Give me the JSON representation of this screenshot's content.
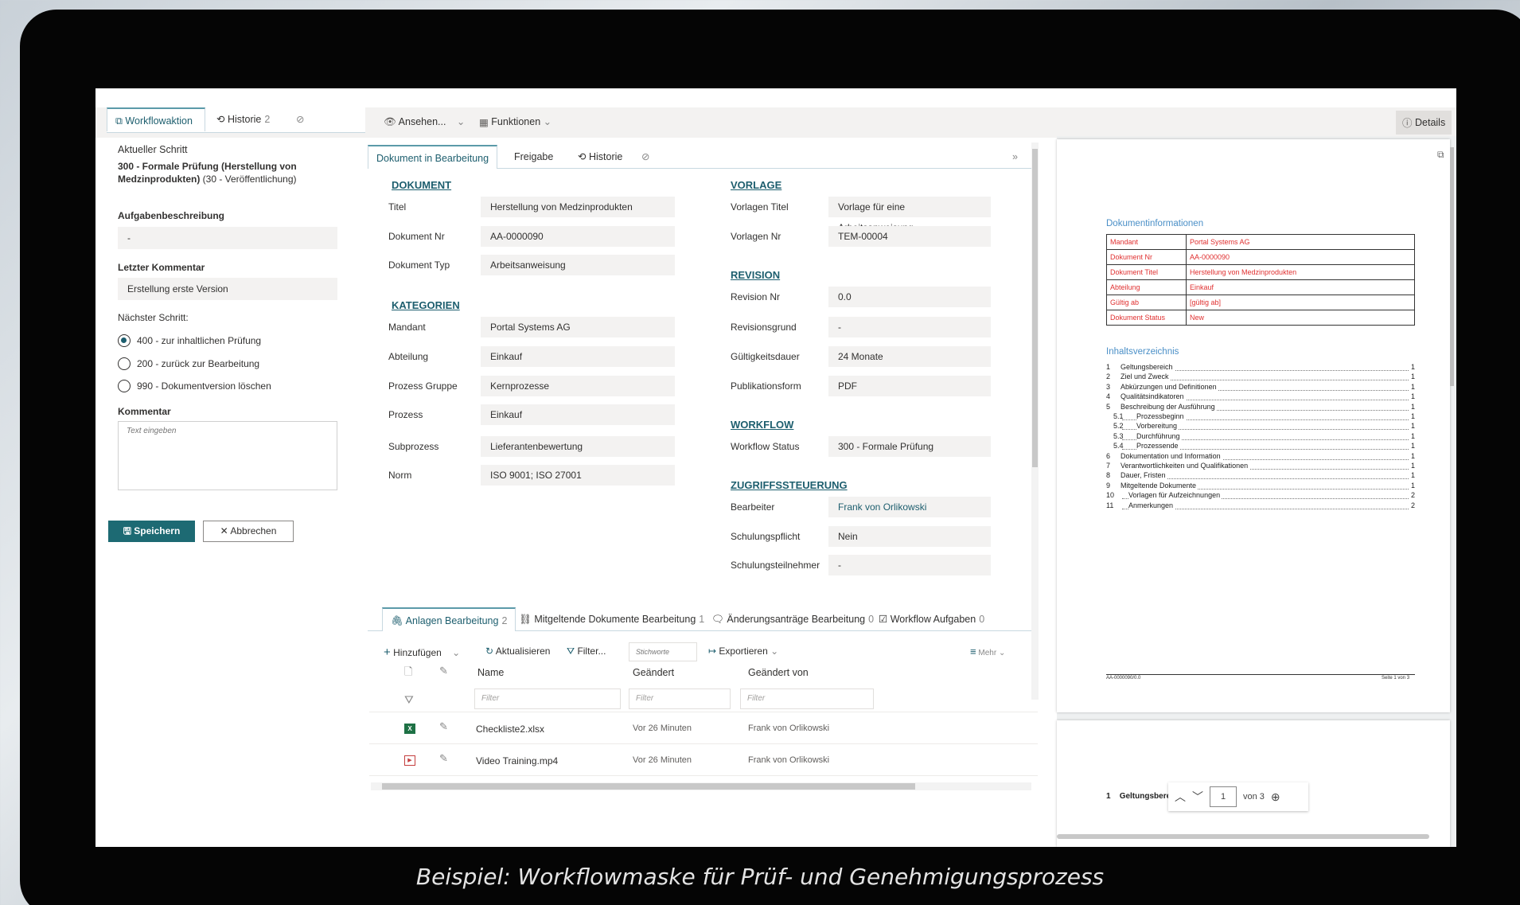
{
  "caption": "Beispiel: Workflowmaske für Prüf- und Genehmigungsprozess",
  "left": {
    "tabs": [
      {
        "label": "Workflowaktion"
      },
      {
        "label": "Historie",
        "count": "2"
      }
    ],
    "current_step_label": "Aktueller Schritt",
    "current_step_bold": "300 - Formale Prüfung (Herstellung von Medzinprodukten)",
    "current_step_rest": " (30 - Veröffentlichung)",
    "task_label": "Aufgabenbeschreibung",
    "task_value": "-",
    "last_comment_label": "Letzter Kommentar",
    "last_comment_value": "Erstellung erste Version",
    "next_step_label": "Nächster Schritt:",
    "options": [
      {
        "label": "400 - zur inhaltlichen Prüfung",
        "selected": true
      },
      {
        "label": "200 - zurück zur Bearbeitung",
        "selected": false
      },
      {
        "label": "990 - Dokumentversion löschen",
        "selected": false
      }
    ],
    "comment_label": "Kommentar",
    "comment_placeholder": "Text eingeben",
    "save_label": "Speichern",
    "cancel_label": "Abbrechen"
  },
  "toolbar": {
    "view_label": "Ansehen...",
    "functions_label": "Funktionen",
    "details_label": "Details"
  },
  "center": {
    "tabs": [
      {
        "label": "Dokument in Bearbeitung"
      },
      {
        "label": "Freigabe"
      },
      {
        "label": "Historie"
      }
    ],
    "sections": {
      "dokument": {
        "title": "DOKUMENT",
        "fields": [
          {
            "label": "Titel",
            "value": "Herstellung von Medzinprodukten"
          },
          {
            "label": "Dokument Nr",
            "value": "AA-0000090"
          },
          {
            "label": "Dokument Typ",
            "value": "Arbeitsanweisung"
          }
        ]
      },
      "kategorien": {
        "title": "KATEGORIEN",
        "fields": [
          {
            "label": "Mandant",
            "value": "Portal Systems AG"
          },
          {
            "label": "Abteilung",
            "value": "Einkauf"
          },
          {
            "label": "Prozess Gruppe",
            "value": "Kernprozesse"
          },
          {
            "label": "Prozess",
            "value": "Einkauf"
          },
          {
            "label": "Subprozess",
            "value": "Lieferantenbewertung"
          },
          {
            "label": "Norm",
            "value": "ISO 9001; ISO 27001"
          }
        ]
      },
      "vorlage": {
        "title": "VORLAGE",
        "fields": [
          {
            "label": "Vorlagen Titel",
            "value": "Vorlage für eine Arbeitsanweisung"
          },
          {
            "label": "Vorlagen Nr",
            "value": "TEM-00004"
          }
        ]
      },
      "revision": {
        "title": "REVISION",
        "fields": [
          {
            "label": "Revision Nr",
            "value": "0.0"
          },
          {
            "label": "Revisionsgrund",
            "value": "-"
          },
          {
            "label": "Gültigkeitsdauer",
            "value": "24 Monate"
          },
          {
            "label": "Publikationsform",
            "value": "PDF"
          }
        ]
      },
      "workflow": {
        "title": "WORKFLOW",
        "fields": [
          {
            "label": "Workflow Status",
            "value": "300 - Formale Prüfung"
          }
        ]
      },
      "zugriff": {
        "title": "ZUGRIFFSSTEUERUNG",
        "fields": [
          {
            "label": "Bearbeiter",
            "value": "Frank von Orlikowski"
          },
          {
            "label": "Schulungspflicht",
            "value": "Nein"
          },
          {
            "label": "Schulungsteilnehmer",
            "value": "-"
          }
        ]
      }
    },
    "bottom_tabs": [
      {
        "label": "Anlagen Bearbeitung",
        "count": "2"
      },
      {
        "label": "Mitgeltende Dokumente Bearbeitung",
        "count": "1"
      },
      {
        "label": "Änderungsanträge Bearbeitung",
        "count": "0"
      },
      {
        "label": "Workflow Aufgaben",
        "count": "0"
      }
    ],
    "cmd": {
      "add": "Hinzufügen",
      "refresh": "Aktualisieren",
      "filter": "Filter...",
      "keyword_placeholder": "Stichworte",
      "export": "Exportieren",
      "more": "Mehr"
    },
    "columns": [
      "Name",
      "Geändert",
      "Geändert von"
    ],
    "filter_placeholder": "Filter",
    "rows": [
      {
        "name": "Checkliste2.xlsx",
        "changed": "Vor 26 Minuten",
        "by": "Frank von Orlikowski"
      },
      {
        "name": "Video Training.mp4",
        "changed": "Vor 26 Minuten",
        "by": "Frank von Orlikowski"
      }
    ]
  },
  "preview": {
    "doc_info_title": "Dokumentinformationen",
    "info": [
      [
        "Mandant",
        "Portal Systems AG"
      ],
      [
        "Dokument Nr",
        "AA-0000090"
      ],
      [
        "Dokument Titel",
        "Herstellung von Medzinprodukten"
      ],
      [
        "Abteilung",
        "Einkauf"
      ],
      [
        "Gültig ab",
        "[gültig ab]"
      ],
      [
        "Dokument Status",
        "New"
      ]
    ],
    "toc_title": "Inhaltsverzeichnis",
    "toc": [
      {
        "num": "1",
        "text": "Geltungsbereich",
        "page": "1",
        "sub": false
      },
      {
        "num": "2",
        "text": "Ziel und Zweck",
        "page": "1",
        "sub": false
      },
      {
        "num": "3",
        "text": "Abkürzungen und Definitionen",
        "page": "1",
        "sub": false
      },
      {
        "num": "4",
        "text": "Qualitätsindikatoren",
        "page": "1",
        "sub": false
      },
      {
        "num": "5",
        "text": "Beschreibung der Ausführung",
        "page": "1",
        "sub": false
      },
      {
        "num": "5.1",
        "text": "Prozessbeginn",
        "page": "1",
        "sub": true
      },
      {
        "num": "5.2",
        "text": "Vorbereitung",
        "page": "1",
        "sub": true
      },
      {
        "num": "5.3",
        "text": "Durchführung",
        "page": "1",
        "sub": true
      },
      {
        "num": "5.4",
        "text": "Prozessende",
        "page": "1",
        "sub": true
      },
      {
        "num": "6",
        "text": "Dokumentation und Information",
        "page": "1",
        "sub": false
      },
      {
        "num": "7",
        "text": "Verantwortlichkeiten und Qualifikationen",
        "page": "1",
        "sub": false
      },
      {
        "num": "8",
        "text": "Dauer, Fristen",
        "page": "1",
        "sub": false
      },
      {
        "num": "9",
        "text": "Mitgeltende Dokumente",
        "page": "1",
        "sub": false
      },
      {
        "num": "10",
        "text": "Vorlagen für Aufzeichnungen",
        "page": "2",
        "sub": false
      },
      {
        "num": "11",
        "text": "Anmerkungen",
        "page": "2",
        "sub": false
      }
    ],
    "footer_left": "AA-0000090/0.0",
    "footer_right": "Seite 1 von 3",
    "page2_num": "1",
    "page2_heading": "Geltungsbereich",
    "page_current": "1",
    "page_total": "von 3"
  }
}
